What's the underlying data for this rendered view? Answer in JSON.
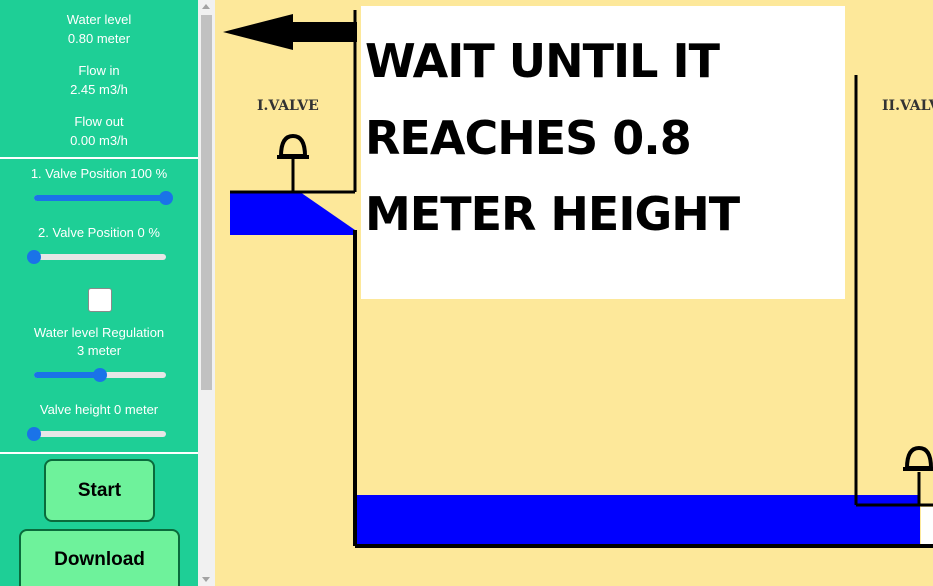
{
  "sidebar": {
    "water_level": {
      "label": "Water level",
      "value": "0.80 meter"
    },
    "flow_in": {
      "label": "Flow in",
      "value": "2.45 m3/h"
    },
    "flow_out": {
      "label": "Flow out",
      "value": "0.00 m3/h"
    },
    "valve1": {
      "label": "1. Valve Position 100 %",
      "value_percent": 100
    },
    "valve2": {
      "label": "2. Valve Position 0 %",
      "value_percent": 0
    },
    "regulation_checkbox": {
      "checked": false
    },
    "regulation": {
      "label": "Water level Regulation",
      "value": "3 meter",
      "value_percent": 50
    },
    "valve_height": {
      "label": "Valve height 0 meter",
      "value_percent": 0
    },
    "start_label": "Start",
    "download_label": "Download"
  },
  "scene": {
    "notice_lines": [
      "WAIT UNTIL IT",
      "REACHES 0.8",
      "METER HEIGHT"
    ],
    "valve1_label": "I.VALVE",
    "valve2_label": "II.VALVE",
    "arrow_icon": "arrow-left-icon"
  },
  "colors": {
    "sidebar_bg": "#1ecf96",
    "scene_bg": "#fde89a",
    "water": "#0000ff",
    "slider": "#1a73e8",
    "button_bg": "#6ef29b"
  }
}
